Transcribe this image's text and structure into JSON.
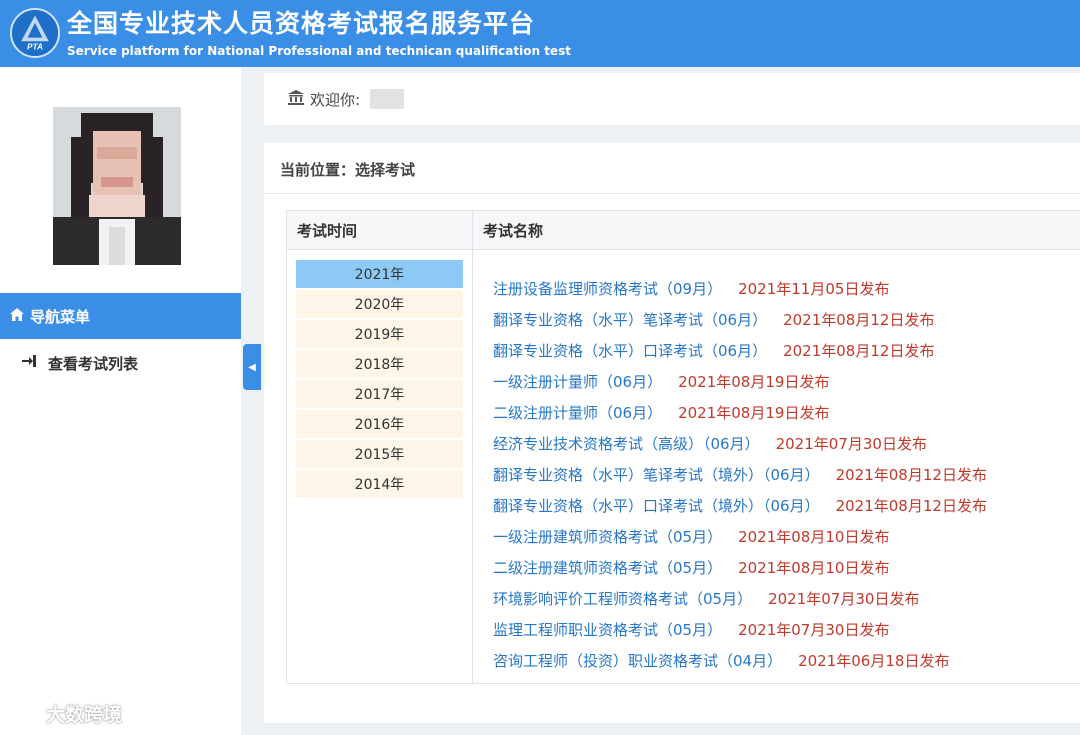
{
  "header": {
    "title": "全国专业技术人员资格考试报名服务平台",
    "subtitle": "Service platform for National Professional and technican qualification test",
    "logo_text": "PTA"
  },
  "sidebar": {
    "nav_header": "导航菜单",
    "nav_header_icon": "home-icon",
    "items": [
      {
        "label": "查看考试列表",
        "icon": "sign-in-icon"
      }
    ]
  },
  "welcome": {
    "icon": "bank-icon",
    "label": "欢迎你:"
  },
  "breadcrumb": {
    "text": "当前位置：选择考试"
  },
  "table": {
    "col_time": "考试时间",
    "col_name": "考试名称",
    "years": [
      "2021年",
      "2020年",
      "2019年",
      "2018年",
      "2017年",
      "2016年",
      "2015年",
      "2014年"
    ],
    "active_year": "2021年",
    "exams": [
      {
        "name": "注册设备监理师资格考试（09月）",
        "date": "2021年11月05日发布"
      },
      {
        "name": "翻译专业资格（水平）笔译考试（06月）",
        "date": "2021年08月12日发布"
      },
      {
        "name": "翻译专业资格（水平）口译考试（06月）",
        "date": "2021年08月12日发布"
      },
      {
        "name": "一级注册计量师（06月）",
        "date": "2021年08月19日发布"
      },
      {
        "name": "二级注册计量师（06月）",
        "date": "2021年08月19日发布"
      },
      {
        "name": "经济专业技术资格考试（高级）（06月）",
        "date": "2021年07月30日发布"
      },
      {
        "name": "翻译专业资格（水平）笔译考试（境外）（06月）",
        "date": "2021年08月12日发布"
      },
      {
        "name": "翻译专业资格（水平）口译考试（境外）（06月）",
        "date": "2021年08月12日发布"
      },
      {
        "name": "一级注册建筑师资格考试（05月）",
        "date": "2021年08月10日发布"
      },
      {
        "name": "二级注册建筑师资格考试（05月）",
        "date": "2021年08月10日发布"
      },
      {
        "name": "环境影响评价工程师资格考试（05月）",
        "date": "2021年07月30日发布"
      },
      {
        "name": "监理工程师职业资格考试（05月）",
        "date": "2021年07月30日发布"
      },
      {
        "name": "咨询工程师（投资）职业资格考试（04月）",
        "date": "2021年06月18日发布"
      }
    ]
  },
  "watermark": {
    "text": "大数跨境"
  },
  "colors": {
    "primary": "#3a8ee6",
    "link": "#2777c7",
    "date": "#c0392b",
    "year_bg": "#fdf5e8",
    "year_active_bg": "#8ccaf5"
  }
}
